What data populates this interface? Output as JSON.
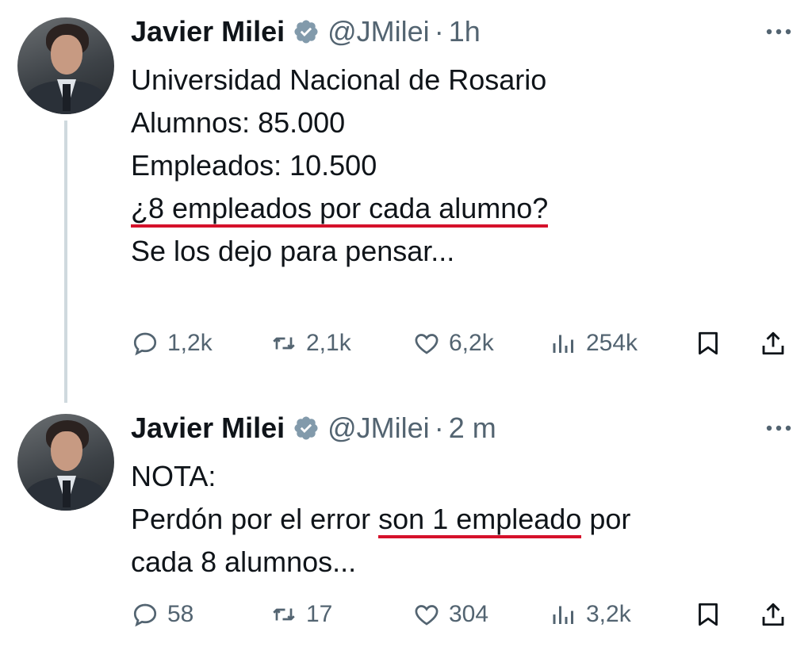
{
  "tweets": [
    {
      "author": {
        "name": "Javier Milei",
        "handle": "@JMilei",
        "time": "1h"
      },
      "lines": [
        "Universidad Nacional de Rosario",
        "Alumnos: 85.000",
        "Empleados: 10.500",
        "¿8 empleados por cada alumno?",
        "Se los dejo para pensar..."
      ],
      "stats": {
        "replies": "1,2k",
        "retweets": "2,1k",
        "likes": "6,2k",
        "views": "254k"
      }
    },
    {
      "author": {
        "name": "Javier Milei",
        "handle": "@JMilei",
        "time": "2 m"
      },
      "lines": {
        "first": "NOTA:",
        "second_before": "Perdón por el error ",
        "second_highlight": "son 1 empleado",
        "second_after": " por",
        "third": "cada 8 alumnos..."
      },
      "stats": {
        "replies": "58",
        "retweets": "17",
        "likes": "304",
        "views": "3,2k"
      }
    }
  ],
  "colors": {
    "text": "#0f1419",
    "muted": "#536471",
    "verified": "#829aab",
    "underline": "#d5112b",
    "thread": "#cfd9de"
  },
  "icons": [
    "verified-badge-icon",
    "more-icon",
    "reply-icon",
    "retweet-icon",
    "like-icon",
    "views-icon",
    "bookmark-icon",
    "share-icon"
  ]
}
